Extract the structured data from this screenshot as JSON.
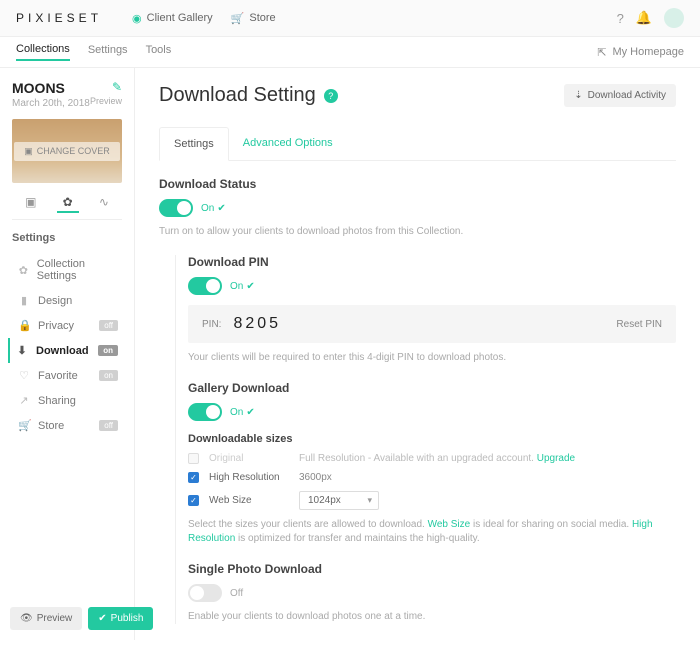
{
  "top": {
    "brand": "PIXIESET",
    "nav": [
      {
        "label": "Client Gallery"
      },
      {
        "label": "Store"
      }
    ],
    "homepage": "My Homepage"
  },
  "subnav": {
    "items": [
      "Collections",
      "Settings",
      "Tools"
    ]
  },
  "collection": {
    "title": "MOONS",
    "date": "March 20th, 2018",
    "preview": "Preview",
    "change_cover": "CHANGE COVER"
  },
  "side_heading": "Settings",
  "side_items": [
    {
      "label": "Collection Settings",
      "badge": ""
    },
    {
      "label": "Design",
      "badge": ""
    },
    {
      "label": "Privacy",
      "badge": "off"
    },
    {
      "label": "Download",
      "badge": "on",
      "active": true
    },
    {
      "label": "Favorite",
      "badge": "on"
    },
    {
      "label": "Sharing",
      "badge": ""
    },
    {
      "label": "Store",
      "badge": "off"
    }
  ],
  "footer": {
    "preview": "Preview",
    "publish": "Publish"
  },
  "page": {
    "title": "Download Setting",
    "activity": "Download Activity",
    "tabs": [
      "Settings",
      "Advanced Options"
    ]
  },
  "status": {
    "label": "Download Status",
    "state": "On",
    "help": "Turn on to allow your clients to download photos from this Collection."
  },
  "pin": {
    "label": "Download PIN",
    "state": "On",
    "field": "PIN:",
    "value": "8205",
    "reset": "Reset PIN",
    "help": "Your clients will be required to enter this 4-digit PIN to download photos."
  },
  "gallery": {
    "label": "Gallery Download",
    "state": "On",
    "sizes_heading": "Downloadable sizes",
    "rows": {
      "orig": {
        "name": "Original",
        "note_pre": "Full Resolution - Available with an upgraded account. ",
        "upgrade": "Upgrade"
      },
      "high": {
        "name": "High Resolution",
        "val": "3600px"
      },
      "web": {
        "name": "Web Size",
        "val": "1024px"
      }
    },
    "help_pre": "Select the sizes your clients are allowed to download. ",
    "help_web": "Web Size",
    "help_mid": " is ideal for sharing on social media. ",
    "help_high": "High Resolution",
    "help_post": " is optimized for transfer and maintains the high-quality."
  },
  "single": {
    "label": "Single Photo Download",
    "state": "Off",
    "help": "Enable your clients to download photos one at a time."
  }
}
